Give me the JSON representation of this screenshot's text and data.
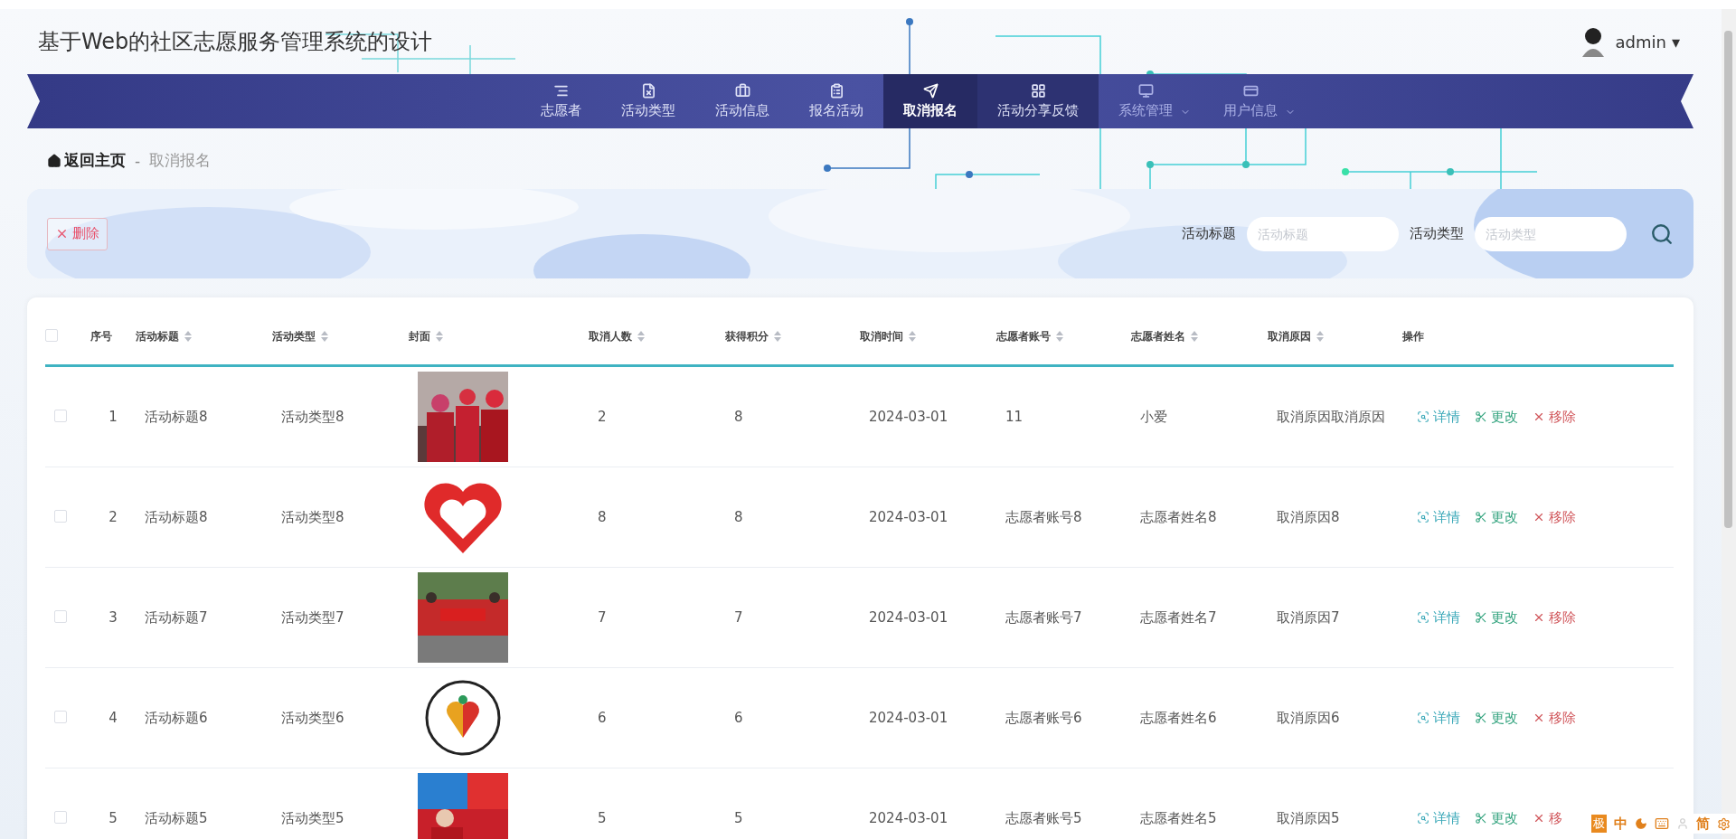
{
  "header": {
    "title": "基于Web的社区志愿服务管理系统的设计",
    "user": {
      "name": "admin",
      "caret": "▾"
    }
  },
  "nav": [
    {
      "label": "志愿者",
      "selected": false,
      "hovered": false,
      "dropdown": false
    },
    {
      "label": "活动类型",
      "selected": false,
      "hovered": false,
      "dropdown": false
    },
    {
      "label": "活动信息",
      "selected": false,
      "hovered": false,
      "dropdown": false
    },
    {
      "label": "报名活动",
      "selected": false,
      "hovered": false,
      "dropdown": false
    },
    {
      "label": "取消报名",
      "selected": true,
      "hovered": false,
      "dropdown": false
    },
    {
      "label": "活动分享反馈",
      "selected": false,
      "hovered": true,
      "dropdown": false
    },
    {
      "label": "系统管理",
      "selected": false,
      "hovered": false,
      "dropdown": true
    },
    {
      "label": "用户信息",
      "selected": false,
      "hovered": false,
      "dropdown": true
    }
  ],
  "breadcrumb": {
    "home": "返回主页",
    "separator": "-",
    "current": "取消报名"
  },
  "toolbar": {
    "delete_button": "删除",
    "filters": [
      {
        "label": "活动标题",
        "placeholder": "活动标题"
      },
      {
        "label": "活动类型",
        "placeholder": "活动类型"
      }
    ]
  },
  "table": {
    "select_all_checked": false,
    "columns": [
      {
        "label": "序号",
        "sortable": false
      },
      {
        "label": "活动标题",
        "sortable": true
      },
      {
        "label": "活动类型",
        "sortable": true
      },
      {
        "label": "封面",
        "sortable": true
      },
      {
        "label": "取消人数",
        "sortable": true
      },
      {
        "label": "获得积分",
        "sortable": true
      },
      {
        "label": "取消时间",
        "sortable": true
      },
      {
        "label": "志愿者账号",
        "sortable": true
      },
      {
        "label": "志愿者姓名",
        "sortable": true
      },
      {
        "label": "取消原因",
        "sortable": true
      },
      {
        "label": "操作",
        "sortable": false
      }
    ],
    "rows": [
      {
        "checked": false,
        "cells": [
          "1",
          "活动标题8",
          "活动类型8",
          null,
          "2",
          "8",
          "2024-03-01",
          "11",
          "小爱",
          "取消原因取消原因"
        ],
        "cover": {
          "kind": "picture"
        },
        "actions": [
          {
            "kind": "detail",
            "label": "详情"
          },
          {
            "kind": "edit",
            "label": "更改"
          },
          {
            "kind": "remove",
            "label": "移除"
          }
        ]
      },
      {
        "checked": false,
        "cells": [
          "2",
          "活动标题8",
          "活动类型8",
          null,
          "8",
          "8",
          "2024-03-01",
          "志愿者账号8",
          "志愿者姓名8",
          "取消原因8"
        ],
        "cover": {
          "kind": "picture"
        },
        "actions": [
          {
            "kind": "detail",
            "label": "详情"
          },
          {
            "kind": "edit",
            "label": "更改"
          },
          {
            "kind": "remove",
            "label": "移除"
          }
        ]
      },
      {
        "checked": false,
        "cells": [
          "3",
          "活动标题7",
          "活动类型7",
          null,
          "7",
          "7",
          "2024-03-01",
          "志愿者账号7",
          "志愿者姓名7",
          "取消原因7"
        ],
        "cover": {
          "kind": "picture"
        },
        "actions": [
          {
            "kind": "detail",
            "label": "详情"
          },
          {
            "kind": "edit",
            "label": "更改"
          },
          {
            "kind": "remove",
            "label": "移除"
          }
        ]
      },
      {
        "checked": false,
        "cells": [
          "4",
          "活动标题6",
          "活动类型6",
          null,
          "6",
          "6",
          "2024-03-01",
          "志愿者账号6",
          "志愿者姓名6",
          "取消原因6"
        ],
        "cover": {
          "kind": "picture"
        },
        "actions": [
          {
            "kind": "detail",
            "label": "详情"
          },
          {
            "kind": "edit",
            "label": "更改"
          },
          {
            "kind": "remove",
            "label": "移除"
          }
        ]
      },
      {
        "checked": false,
        "cells": [
          "5",
          "活动标题5",
          "活动类型5",
          null,
          "5",
          "5",
          "2024-03-01",
          "志愿者账号5",
          "志愿者姓名5",
          "取消原因5"
        ],
        "cover": {
          "kind": "picture"
        },
        "actions": [
          {
            "kind": "detail",
            "label": "详情"
          },
          {
            "kind": "edit",
            "label": "更改"
          },
          {
            "kind": "remove",
            "label": "移"
          }
        ]
      }
    ]
  },
  "ime_toolbar": {
    "logo": "极",
    "mode": "中",
    "script": "简"
  }
}
